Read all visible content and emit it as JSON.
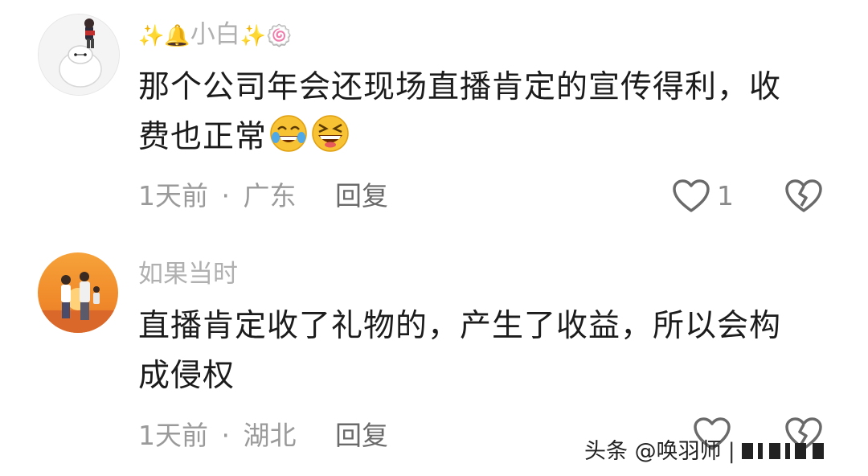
{
  "comments": [
    {
      "username": "小白",
      "username_deco_left": "✨🔔",
      "username_deco_right": "✨🍥",
      "content_line1": "那个公司年会还现场直播肯定的宣传得利，收",
      "content_line2": "费也正常",
      "emojis": [
        "rofl-emoji",
        "laughing-emoji"
      ],
      "time": "1天前",
      "location": "广东",
      "separator": "·",
      "reply_label": "回复",
      "like_count": "1"
    },
    {
      "username": "如果当时",
      "content_line1": "直播肯定收了礼物的，产生了收益，所以会构",
      "content_line2": "成侵权",
      "time": "1天前",
      "location": "湖北",
      "separator": "·",
      "reply_label": "回复",
      "like_count": ""
    }
  ],
  "watermark": {
    "text": "头条 @唤羽师",
    "trailing": "|"
  },
  "colors": {
    "meta_gray": "#9a9a9a",
    "content_dark": "#1c1c1c",
    "username_gray": "#b0b0b0"
  }
}
